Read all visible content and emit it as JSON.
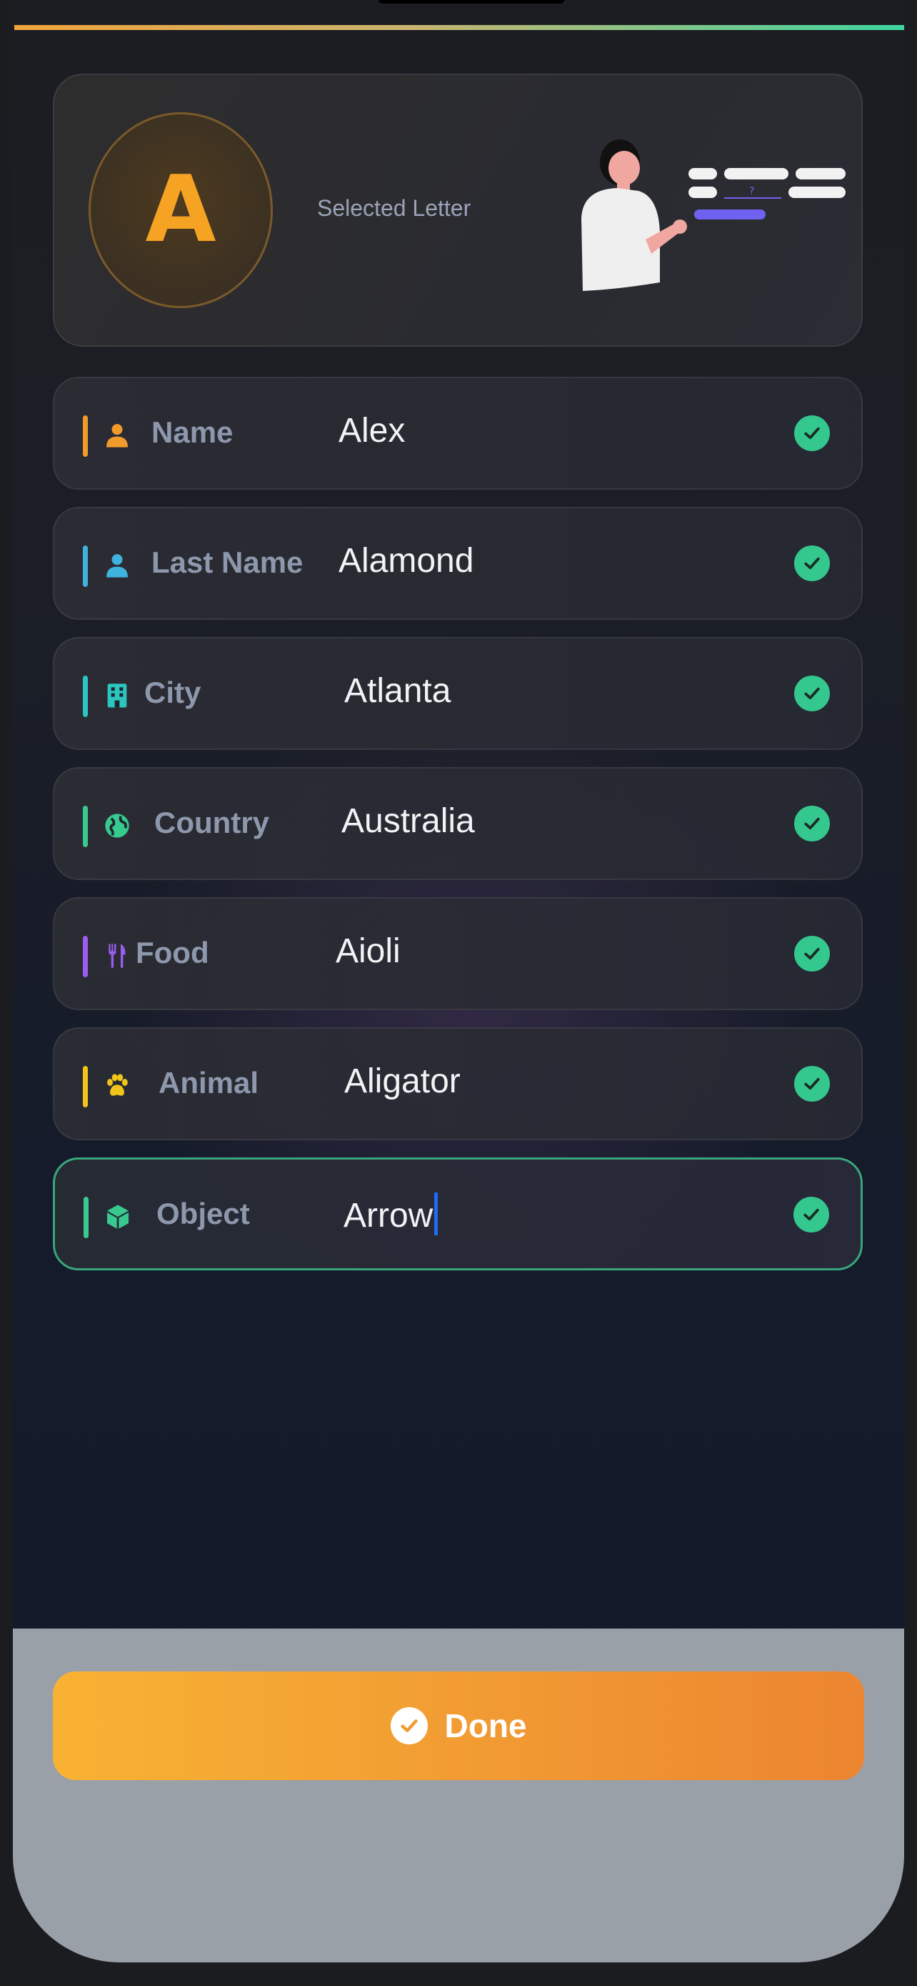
{
  "hero": {
    "letter": "A",
    "label": "Selected Letter"
  },
  "fields": [
    {
      "label": "Name",
      "value": "Alex",
      "icon": "person-icon",
      "accent": "#f29b2c",
      "valid": true
    },
    {
      "label": "Last Name",
      "value": "Alamond",
      "icon": "person-icon",
      "accent": "#3db3de",
      "valid": true
    },
    {
      "label": "City",
      "value": "Atlanta",
      "icon": "building-icon",
      "accent": "#2cc6c0",
      "valid": true
    },
    {
      "label": "Country",
      "value": "Australia",
      "icon": "globe-icon",
      "accent": "#38c98f",
      "valid": true
    },
    {
      "label": "Food",
      "value": "Aioli",
      "icon": "fork-knife-icon",
      "accent": "#9b5cf0",
      "valid": true
    },
    {
      "label": "Animal",
      "value": "Aligator",
      "icon": "paw-icon",
      "accent": "#f0c419",
      "valid": true
    },
    {
      "label": "Object",
      "value": "Arrow",
      "icon": "cube-icon",
      "accent": "#38c98f",
      "valid": true,
      "focused": true
    }
  ],
  "actions": {
    "done_label": "Done"
  },
  "colors": {
    "accent_orange": "#f6a323",
    "valid_green": "#34c88e",
    "focus_border": "#3aa57c"
  }
}
